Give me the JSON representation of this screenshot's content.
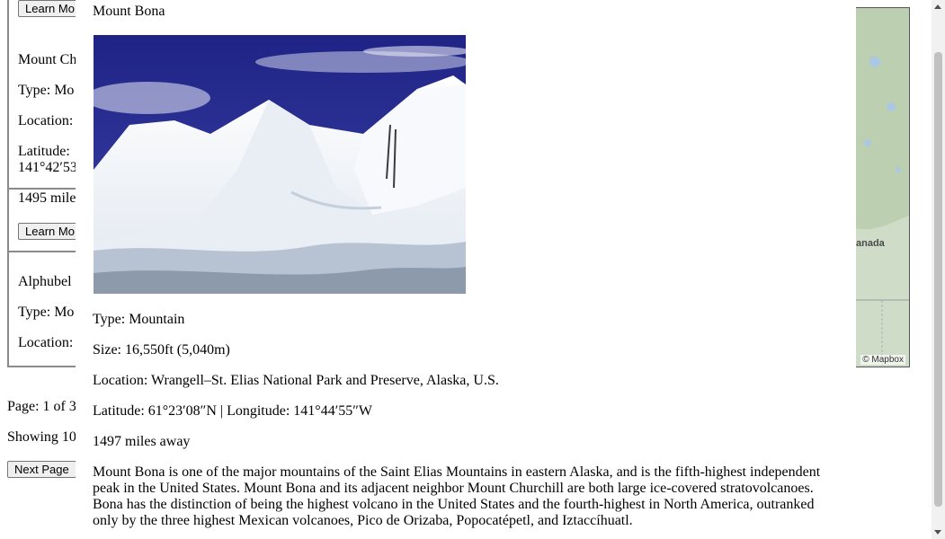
{
  "results": {
    "cards": [
      {
        "button_label": "Learn Mo"
      },
      {
        "name": "Mount Ch",
        "type": "Type: Mo",
        "location": "Location:",
        "lat": "Latitude: ",
        "lon": "141°42′53",
        "distance": "1495 mile",
        "button_label": "Learn Mo"
      },
      {
        "name": "Alphubel",
        "type": "Type: Mo",
        "location": "Location:"
      }
    ]
  },
  "pager": {
    "page_text": "Page: 1 of 3",
    "showing_text": "Showing 10",
    "next_label": "Next Page"
  },
  "map": {
    "label": "anada",
    "attribution": "© Mapbox"
  },
  "modal": {
    "title": "Mount Bona",
    "type": "Type: Mountain",
    "size": "Size: 16,550ft (5,040m)",
    "location": "Location: Wrangell–St. Elias National Park and Preserve, Alaska, U.S.",
    "coordinates": "Latitude: 61°23′08″N | Longitude: 141°44′55″W",
    "distance": "1497 miles away",
    "description": "Mount Bona is one of the major mountains of the Saint Elias Mountains in eastern Alaska, and is the fifth-highest independent peak in the United States. Mount Bona and its adjacent neighbor Mount Churchill are both large ice-covered stratovolcanoes. Bona has the distinction of being the highest volcano in the United States and the fourth-highest in North America, outranked only by the three highest Mexican volcanoes, Pico de Orizaba, Popocatépetl, and Iztaccíhuatl."
  },
  "colors": {
    "sky": "#2b2f8f",
    "snow": "#f2f5fa",
    "ice_shadow": "#a9b7c9",
    "border": "#8a8a8a"
  }
}
